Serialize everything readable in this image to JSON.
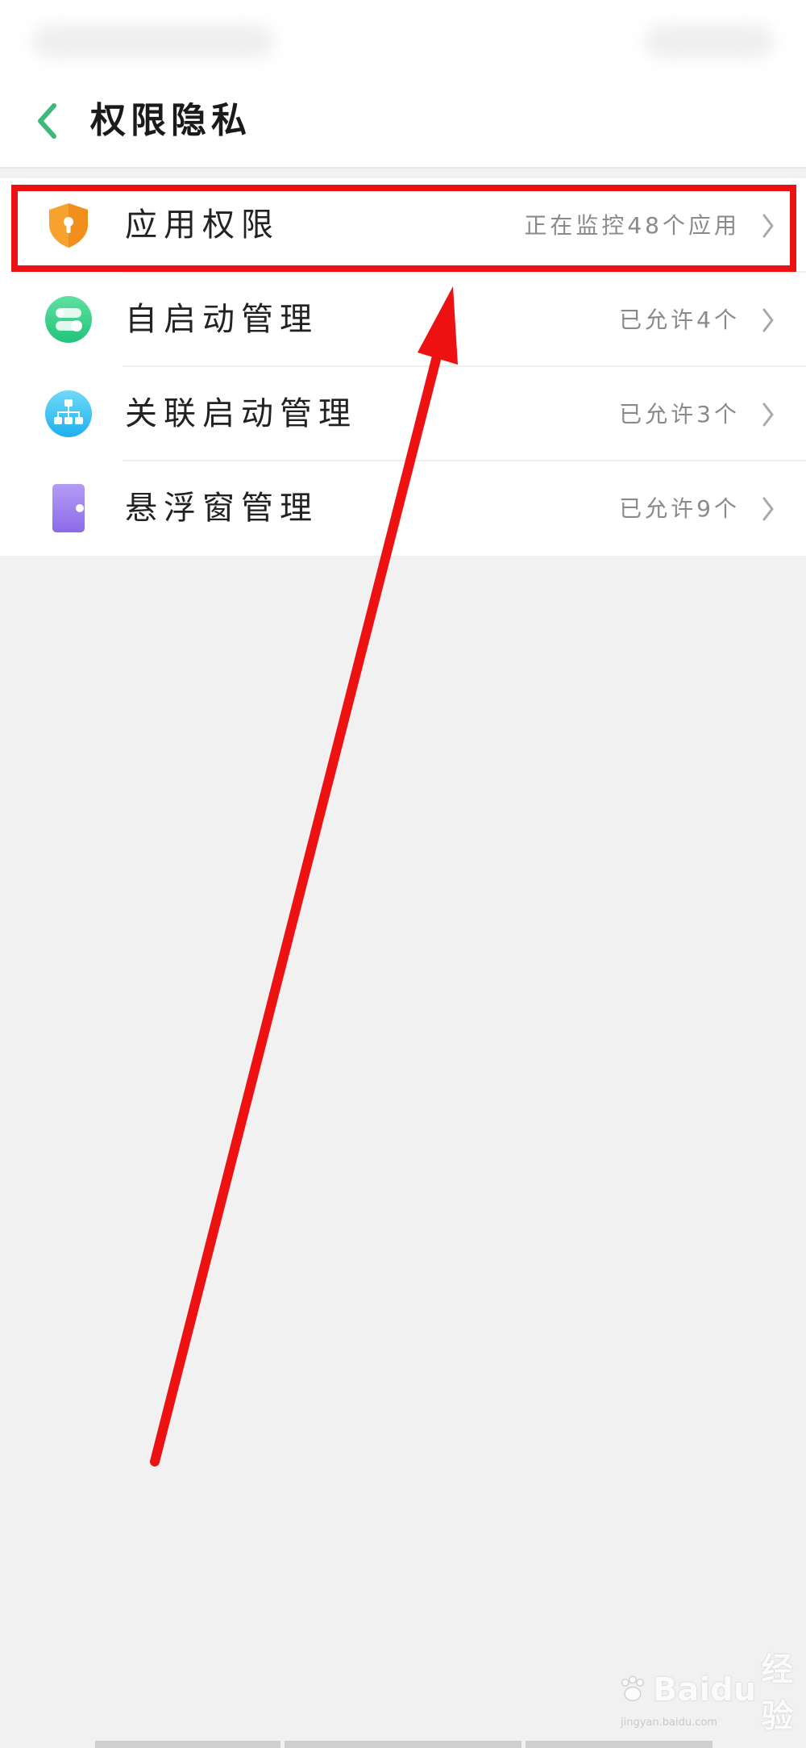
{
  "header": {
    "title": "权限隐私"
  },
  "list": {
    "items": [
      {
        "label": "应用权限",
        "status": "正在监控48个应用",
        "icon": "shield-lock-icon"
      },
      {
        "label": "自启动管理",
        "status": "已允许4个",
        "icon": "toggle-switch-icon"
      },
      {
        "label": "关联启动管理",
        "status": "已允许3个",
        "icon": "network-tree-icon"
      },
      {
        "label": "悬浮窗管理",
        "status": "已允许9个",
        "icon": "floating-window-icon"
      }
    ]
  },
  "annotation": {
    "highlight_color": "#ee1111"
  },
  "watermark": {
    "brand": "Baidu",
    "brand_cn": "经验",
    "url": "jingyan.baidu.com"
  },
  "colors": {
    "accent": "#3dba7a",
    "background": "#f1f1f1"
  }
}
